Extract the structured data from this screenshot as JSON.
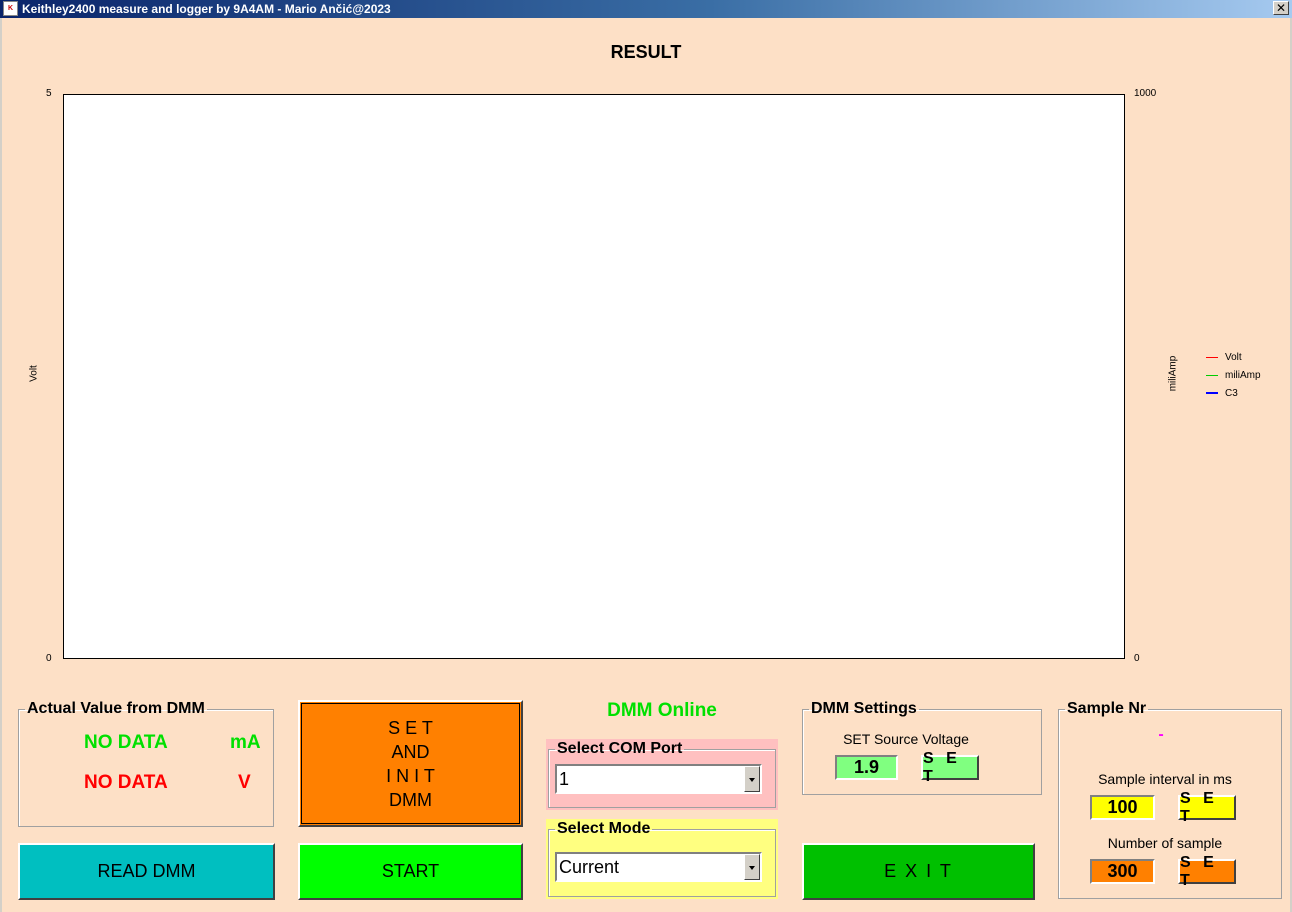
{
  "window": {
    "title": "Keithley2400 measure and logger by 9A4AM - Mario Ančić@2023",
    "icon_name": "keithley-app-icon",
    "close_glyph": "✕"
  },
  "chart": {
    "title": "RESULT",
    "y_left_label": "Volt",
    "y_right_label": "miliAmp",
    "y_left_max": "5",
    "y_left_min": "0",
    "y_right_max": "1000",
    "y_right_min": "0",
    "legend": [
      {
        "name": "Volt",
        "color": "#ff0000"
      },
      {
        "name": "miliAmp",
        "color": "#00cc00"
      },
      {
        "name": "C3",
        "color": "#0000ff"
      }
    ]
  },
  "chart_data": {
    "type": "line",
    "title": "RESULT",
    "ylabel": "Volt",
    "y2label": "miliAmp",
    "ylim": [
      0,
      5
    ],
    "y2lim": [
      0,
      1000
    ],
    "series": [
      {
        "name": "Volt",
        "values": []
      },
      {
        "name": "miliAmp",
        "values": []
      },
      {
        "name": "C3",
        "values": []
      }
    ],
    "legend_position": "right"
  },
  "actual_value": {
    "legend": "Actual Value from DMM",
    "current_value": "NO DATA",
    "current_unit": "mA",
    "voltage_value": "NO DATA",
    "voltage_unit": "V",
    "current_color": "#00e000",
    "voltage_color": "#ff0000"
  },
  "buttons": {
    "read_dmm": "READ DMM",
    "set_init_line1": "S E T",
    "set_init_line2": "AND",
    "set_init_line3": "I N I T",
    "set_init_line4": "DMM",
    "start": "START",
    "exit": "E X I T",
    "set_label": "S E T"
  },
  "status": {
    "dmm_status": "DMM Online",
    "color": "#00e000"
  },
  "com_port": {
    "legend": "Select COM Port",
    "selected": "1"
  },
  "mode": {
    "legend": "Select Mode",
    "selected": "Current"
  },
  "dmm_settings": {
    "legend": "DMM Settings",
    "source_voltage_label": "SET Source Voltage",
    "source_voltage_value": "1.9"
  },
  "sample": {
    "legend": "Sample Nr",
    "sample_nr_value": "-",
    "interval_label": "Sample interval in ms",
    "interval_value": "100",
    "count_label": "Number of sample",
    "count_value": "300"
  },
  "colors": {
    "background": "#fde0c6",
    "read_dmm_button": "#00bfc0",
    "set_init_button": "#ff8000",
    "start_button": "#00ff00",
    "exit_button": "#00c000",
    "com_port_panel": "#ffc0c0",
    "mode_panel": "#ffff80",
    "voltage_box": "#80ff80",
    "interval_box": "#ffff00",
    "count_box": "#ff8000"
  }
}
